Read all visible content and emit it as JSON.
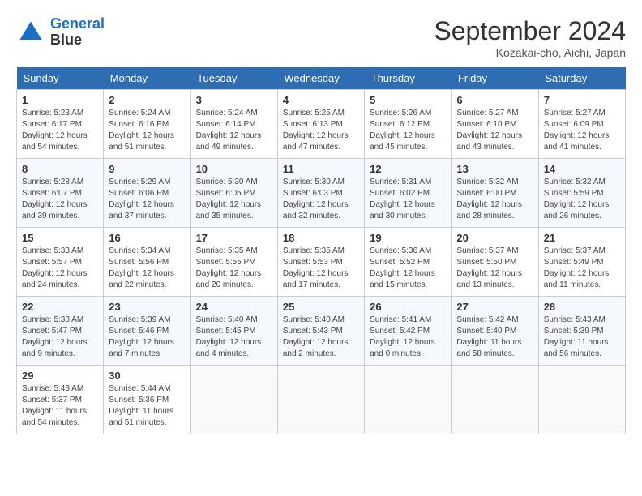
{
  "header": {
    "logo_line1": "General",
    "logo_line2": "Blue",
    "month": "September 2024",
    "location": "Kozakai-cho, Aichi, Japan"
  },
  "days_of_week": [
    "Sunday",
    "Monday",
    "Tuesday",
    "Wednesday",
    "Thursday",
    "Friday",
    "Saturday"
  ],
  "weeks": [
    [
      {
        "day": "1",
        "info": "Sunrise: 5:23 AM\nSunset: 6:17 PM\nDaylight: 12 hours\nand 54 minutes."
      },
      {
        "day": "2",
        "info": "Sunrise: 5:24 AM\nSunset: 6:16 PM\nDaylight: 12 hours\nand 51 minutes."
      },
      {
        "day": "3",
        "info": "Sunrise: 5:24 AM\nSunset: 6:14 PM\nDaylight: 12 hours\nand 49 minutes."
      },
      {
        "day": "4",
        "info": "Sunrise: 5:25 AM\nSunset: 6:13 PM\nDaylight: 12 hours\nand 47 minutes."
      },
      {
        "day": "5",
        "info": "Sunrise: 5:26 AM\nSunset: 6:12 PM\nDaylight: 12 hours\nand 45 minutes."
      },
      {
        "day": "6",
        "info": "Sunrise: 5:27 AM\nSunset: 6:10 PM\nDaylight: 12 hours\nand 43 minutes."
      },
      {
        "day": "7",
        "info": "Sunrise: 5:27 AM\nSunset: 6:09 PM\nDaylight: 12 hours\nand 41 minutes."
      }
    ],
    [
      {
        "day": "8",
        "info": "Sunrise: 5:28 AM\nSunset: 6:07 PM\nDaylight: 12 hours\nand 39 minutes."
      },
      {
        "day": "9",
        "info": "Sunrise: 5:29 AM\nSunset: 6:06 PM\nDaylight: 12 hours\nand 37 minutes."
      },
      {
        "day": "10",
        "info": "Sunrise: 5:30 AM\nSunset: 6:05 PM\nDaylight: 12 hours\nand 35 minutes."
      },
      {
        "day": "11",
        "info": "Sunrise: 5:30 AM\nSunset: 6:03 PM\nDaylight: 12 hours\nand 32 minutes."
      },
      {
        "day": "12",
        "info": "Sunrise: 5:31 AM\nSunset: 6:02 PM\nDaylight: 12 hours\nand 30 minutes."
      },
      {
        "day": "13",
        "info": "Sunrise: 5:32 AM\nSunset: 6:00 PM\nDaylight: 12 hours\nand 28 minutes."
      },
      {
        "day": "14",
        "info": "Sunrise: 5:32 AM\nSunset: 5:59 PM\nDaylight: 12 hours\nand 26 minutes."
      }
    ],
    [
      {
        "day": "15",
        "info": "Sunrise: 5:33 AM\nSunset: 5:57 PM\nDaylight: 12 hours\nand 24 minutes."
      },
      {
        "day": "16",
        "info": "Sunrise: 5:34 AM\nSunset: 5:56 PM\nDaylight: 12 hours\nand 22 minutes."
      },
      {
        "day": "17",
        "info": "Sunrise: 5:35 AM\nSunset: 5:55 PM\nDaylight: 12 hours\nand 20 minutes."
      },
      {
        "day": "18",
        "info": "Sunrise: 5:35 AM\nSunset: 5:53 PM\nDaylight: 12 hours\nand 17 minutes."
      },
      {
        "day": "19",
        "info": "Sunrise: 5:36 AM\nSunset: 5:52 PM\nDaylight: 12 hours\nand 15 minutes."
      },
      {
        "day": "20",
        "info": "Sunrise: 5:37 AM\nSunset: 5:50 PM\nDaylight: 12 hours\nand 13 minutes."
      },
      {
        "day": "21",
        "info": "Sunrise: 5:37 AM\nSunset: 5:49 PM\nDaylight: 12 hours\nand 11 minutes."
      }
    ],
    [
      {
        "day": "22",
        "info": "Sunrise: 5:38 AM\nSunset: 5:47 PM\nDaylight: 12 hours\nand 9 minutes."
      },
      {
        "day": "23",
        "info": "Sunrise: 5:39 AM\nSunset: 5:46 PM\nDaylight: 12 hours\nand 7 minutes."
      },
      {
        "day": "24",
        "info": "Sunrise: 5:40 AM\nSunset: 5:45 PM\nDaylight: 12 hours\nand 4 minutes."
      },
      {
        "day": "25",
        "info": "Sunrise: 5:40 AM\nSunset: 5:43 PM\nDaylight: 12 hours\nand 2 minutes."
      },
      {
        "day": "26",
        "info": "Sunrise: 5:41 AM\nSunset: 5:42 PM\nDaylight: 12 hours\nand 0 minutes."
      },
      {
        "day": "27",
        "info": "Sunrise: 5:42 AM\nSunset: 5:40 PM\nDaylight: 11 hours\nand 58 minutes."
      },
      {
        "day": "28",
        "info": "Sunrise: 5:43 AM\nSunset: 5:39 PM\nDaylight: 11 hours\nand 56 minutes."
      }
    ],
    [
      {
        "day": "29",
        "info": "Sunrise: 5:43 AM\nSunset: 5:37 PM\nDaylight: 11 hours\nand 54 minutes."
      },
      {
        "day": "30",
        "info": "Sunrise: 5:44 AM\nSunset: 5:36 PM\nDaylight: 11 hours\nand 51 minutes."
      },
      {
        "day": "",
        "info": ""
      },
      {
        "day": "",
        "info": ""
      },
      {
        "day": "",
        "info": ""
      },
      {
        "day": "",
        "info": ""
      },
      {
        "day": "",
        "info": ""
      }
    ]
  ]
}
